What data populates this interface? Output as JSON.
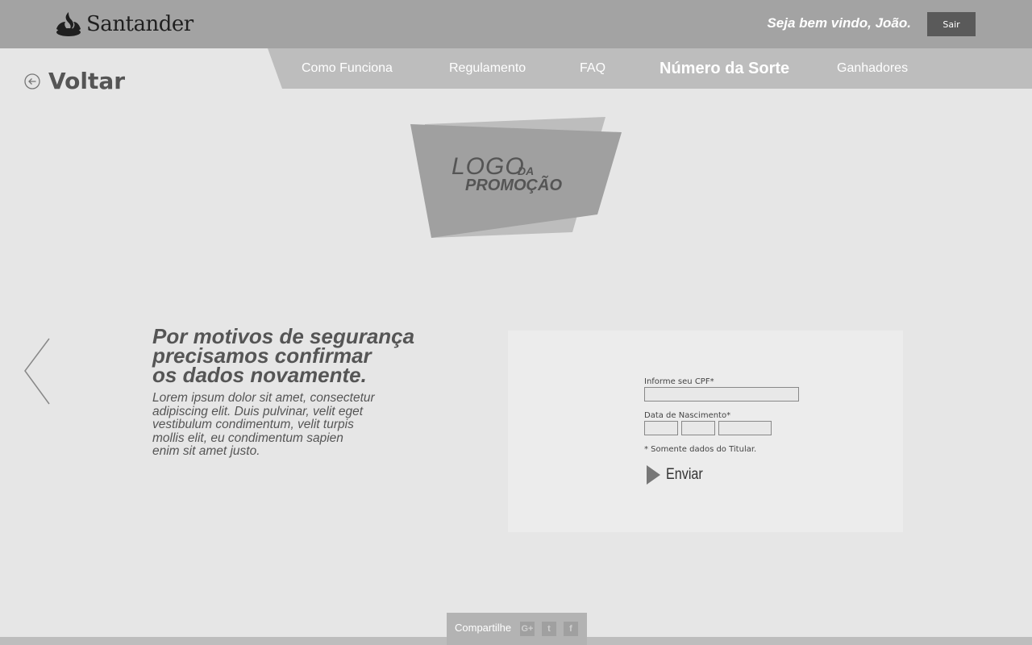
{
  "header": {
    "brand": "Santander",
    "brand_icon": "flame-logo-icon",
    "welcome": "Seja bem vindo, João.",
    "logout_label": "Sair"
  },
  "nav": {
    "items": [
      {
        "label": "Como Funciona",
        "active": false
      },
      {
        "label": "Regulamento",
        "active": false
      },
      {
        "label": "FAQ",
        "active": false
      },
      {
        "label": "Número da Sorte",
        "active": true
      },
      {
        "label": "Ganhadores",
        "active": false
      }
    ]
  },
  "back": {
    "label": "Voltar",
    "icon": "arrow-left-circle-icon"
  },
  "promo_logo": {
    "word1": "LOGO",
    "word2": "DA",
    "word3": "PROMOÇÃO"
  },
  "content": {
    "headline_lines": [
      "Por motivos de segurança",
      "precisamos confirmar",
      "os dados novamente."
    ],
    "body_lines": [
      "Lorem ipsum dolor sit amet, consectetur",
      "adipiscing elit. Duis pulvinar, velit eget",
      "vestibulum condimentum, velit turpis",
      "mollis elit, eu condimentum sapien",
      "enim sit amet justo."
    ]
  },
  "form": {
    "cpf_label": "Informe seu CPF*",
    "cpf_value": "",
    "birth_label": "Data de Nascimento*",
    "birth_day": "",
    "birth_month": "",
    "birth_year": "",
    "note": "* Somente dados do Titular.",
    "submit_label": "Enviar"
  },
  "footer": {
    "share_label": "Compartilhe",
    "social": [
      "G+",
      "t",
      "f"
    ]
  },
  "colors": {
    "header_bg": "#a3a3a3",
    "nav_bg": "#bdbdbd",
    "page_bg": "#e6e6e6",
    "button_dark": "#5a5a5a"
  }
}
